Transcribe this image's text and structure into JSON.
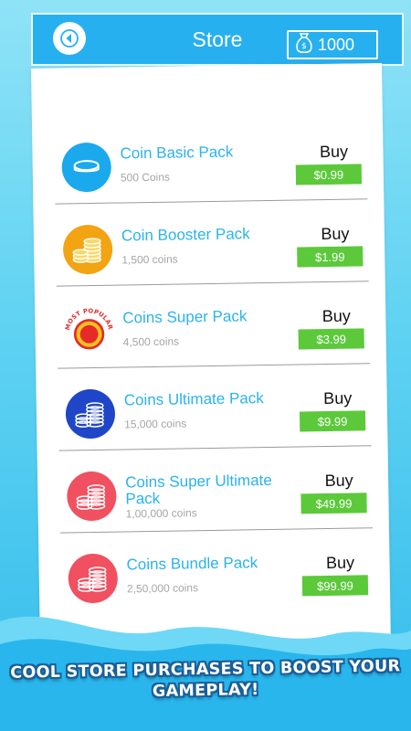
{
  "header": {
    "title": "Store",
    "balance": "1000",
    "back_icon": "back-arrow-icon",
    "wallet_icon": "money-bag-icon"
  },
  "packs": [
    {
      "name": "Coin Basic Pack",
      "count": "500 Coins",
      "buy_label": "Buy",
      "price": "$0.99",
      "icon": "single-coin-icon",
      "color": "#1aa9ec"
    },
    {
      "name": "Coin Booster Pack",
      "count": "1,500 coins",
      "buy_label": "Buy",
      "price": "$1.99",
      "icon": "coin-stacks-icon",
      "color": "#f2a413"
    },
    {
      "name": "Coins Super Pack",
      "count": "4,500 coins",
      "buy_label": "Buy",
      "price": "$3.99",
      "icon": "most-popular-badge-icon",
      "badge": "MOST POPULAR",
      "color": "#e62a2a"
    },
    {
      "name": "Coins Ultimate Pack",
      "count": "15,000 coins",
      "buy_label": "Buy",
      "price": "$9.99",
      "icon": "coin-stacks-icon",
      "color": "#1f46c8"
    },
    {
      "name": "Coins Super Ultimate Pack",
      "count": "1,00,000 coins",
      "buy_label": "Buy",
      "price": "$49.99",
      "icon": "coin-stacks-icon",
      "color": "#f05060"
    },
    {
      "name": "Coins Bundle Pack",
      "count": "2,50,000 coins",
      "buy_label": "Buy",
      "price": "$99.99",
      "icon": "coin-stacks-icon",
      "color": "#f05060"
    }
  ],
  "banner": {
    "line1": "COOL STORE PURCHASES TO BOOST YOUR",
    "line2": "GAMEPLAY!"
  },
  "colors": {
    "accent_blue": "#27b0f0",
    "price_green": "#5cc93b",
    "pack_name_blue": "#2bb3ee"
  }
}
